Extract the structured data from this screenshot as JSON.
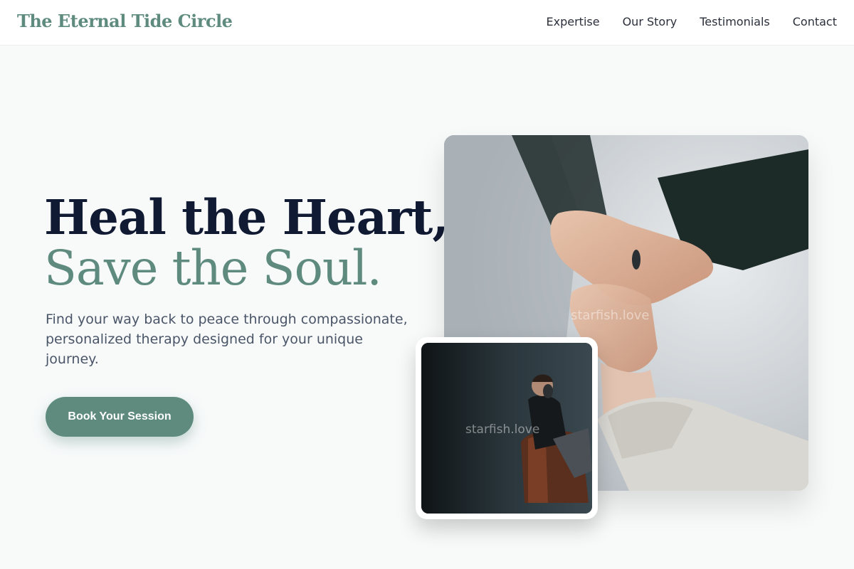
{
  "header": {
    "logo": "The Eternal Tide Circle",
    "nav": [
      "Expertise",
      "Our Story",
      "Testimonials",
      "Contact"
    ]
  },
  "hero": {
    "title_line1": "Heal the Heart,",
    "title_line2": "Save the Soul.",
    "subtitle": "Find your way back to peace through compassionate, personalized therapy designed for your unique journey.",
    "cta_label": "Book Your Session"
  },
  "images": {
    "main_watermark": "starfish.love",
    "inset_watermark": "starfish.love"
  },
  "colors": {
    "accent": "#5e8b7e",
    "heading": "#111a33",
    "body_text": "#4a5568",
    "background": "#f8fafa"
  }
}
